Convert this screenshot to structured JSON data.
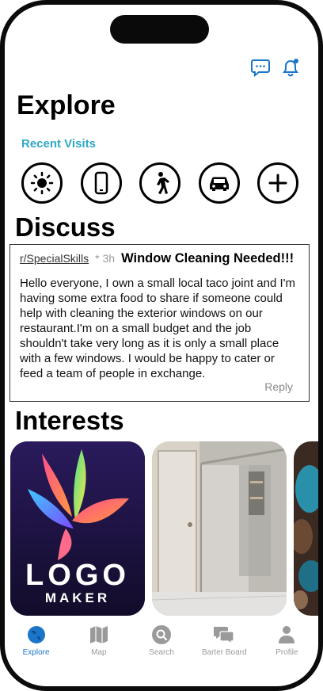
{
  "header": {
    "title": "Explore"
  },
  "recent": {
    "label": "Recent Visits",
    "items": [
      {
        "icon": "sun-icon"
      },
      {
        "icon": "phone-icon"
      },
      {
        "icon": "walking-person-icon"
      },
      {
        "icon": "car-icon"
      },
      {
        "icon": "plus-icon"
      }
    ]
  },
  "discuss": {
    "title": "Discuss",
    "post": {
      "subreddit": "r/SpecialSkills",
      "time": "* 3h",
      "title": "Window Cleaning Needed!!!",
      "body": "Hello everyone, I own a small local taco joint and I'm having some extra food to share if someone could help with cleaning the exterior windows on our restaurant.I'm on a small budget and the job shouldn't take very long as it is only a small place with a few windows. I would be happy to cater or feed a team of people in exchange.",
      "reply": "Reply"
    }
  },
  "interests": {
    "title": "Interests",
    "logo_maker_text_1": "LOGO",
    "logo_maker_text_2": "MAKER"
  },
  "tabs": [
    {
      "label": "Explore",
      "icon": "globe-icon",
      "active": true
    },
    {
      "label": "Map",
      "icon": "map-icon"
    },
    {
      "label": "Search",
      "icon": "search-icon"
    },
    {
      "label": "Barter Board",
      "icon": "chat-bubbles-icon"
    },
    {
      "label": "Profile",
      "icon": "person-icon"
    }
  ],
  "colors": {
    "accent": "#30a8c6",
    "active_tab": "#1b76c9",
    "inactive_tab": "#9a9a9a"
  }
}
